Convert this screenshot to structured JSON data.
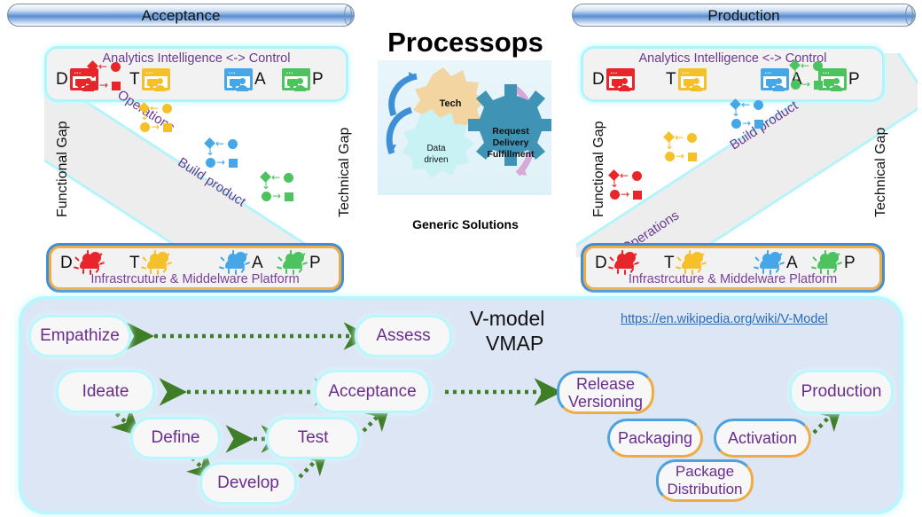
{
  "headers": {
    "left": "Acceptance",
    "right": "Production"
  },
  "center": {
    "title": "Processops",
    "caption": "Generic Solutions",
    "gears": [
      {
        "label": "Tech",
        "color": "#f2d5a0"
      },
      {
        "label": "Data driven",
        "color": "#c9f2f5"
      },
      {
        "label": "Request\nDelivery\nFulfillment",
        "color": "#3f94b5"
      }
    ],
    "gear_labels": {
      "tech": "Tech",
      "data_driven_line1": "Data",
      "data_driven_line2": "driven",
      "request_line1": "Request",
      "request_line2": "Delivery",
      "request_line3": "Fulfillment"
    }
  },
  "panel_left": {
    "analytics_title": "Analytics Intelligence  <->  Control",
    "infra_title": "Infrastrcuture & Middelware Platform",
    "gap_left": "Functional Gap",
    "gap_right": "Technical Gap",
    "diagonal_labels": [
      "Operations",
      "Build product"
    ],
    "stage_letters": [
      "D",
      "T",
      "A",
      "P"
    ],
    "stage_colors": [
      "#e8252a",
      "#f5c028",
      "#45a6e8",
      "#4cc35e"
    ]
  },
  "panel_right": {
    "analytics_title": "Analytics Intelligence  <->  Control",
    "infra_title": "Infrastrcuture & Middelware Platform",
    "gap_left": "Functional Gap",
    "gap_right": "Technical Gap",
    "diagonal_labels": [
      "Build product",
      "Operations"
    ],
    "stage_letters": [
      "D",
      "T",
      "A",
      "P"
    ],
    "stage_colors": [
      "#e8252a",
      "#f5c028",
      "#45a6e8",
      "#4cc35e"
    ]
  },
  "vmodel": {
    "title_line1": "V-model",
    "title_line2": "VMAP",
    "link": "https://en.wikipedia.org/wiki/V-Model",
    "left_nodes": [
      {
        "label": "Empathize"
      },
      {
        "label": "Ideate"
      },
      {
        "label": "Define"
      },
      {
        "label": "Develop"
      },
      {
        "label": "Test"
      },
      {
        "label": "Acceptance"
      },
      {
        "label": "Assess"
      }
    ],
    "right_nodes": [
      {
        "label": "Release\nVersioning",
        "l1": "Release",
        "l2": "Versioning"
      },
      {
        "label": "Packaging",
        "l1": "Packaging",
        "l2": ""
      },
      {
        "label": "Package\nDistribution",
        "l1": "Package",
        "l2": "Distribution"
      },
      {
        "label": "Activation",
        "l1": "Activation",
        "l2": ""
      },
      {
        "label": "Production",
        "l1": "Production",
        "l2": ""
      }
    ]
  },
  "colors": {
    "purple_text": "#6a3a8f",
    "cyan_glow": "#b9f7fd",
    "orange_border": "#efab45",
    "blue_border": "#4ea3dd",
    "arrow_green": "#3f7d28",
    "link_blue": "#2b6cb8",
    "panel_bg": "#dde6f4"
  }
}
